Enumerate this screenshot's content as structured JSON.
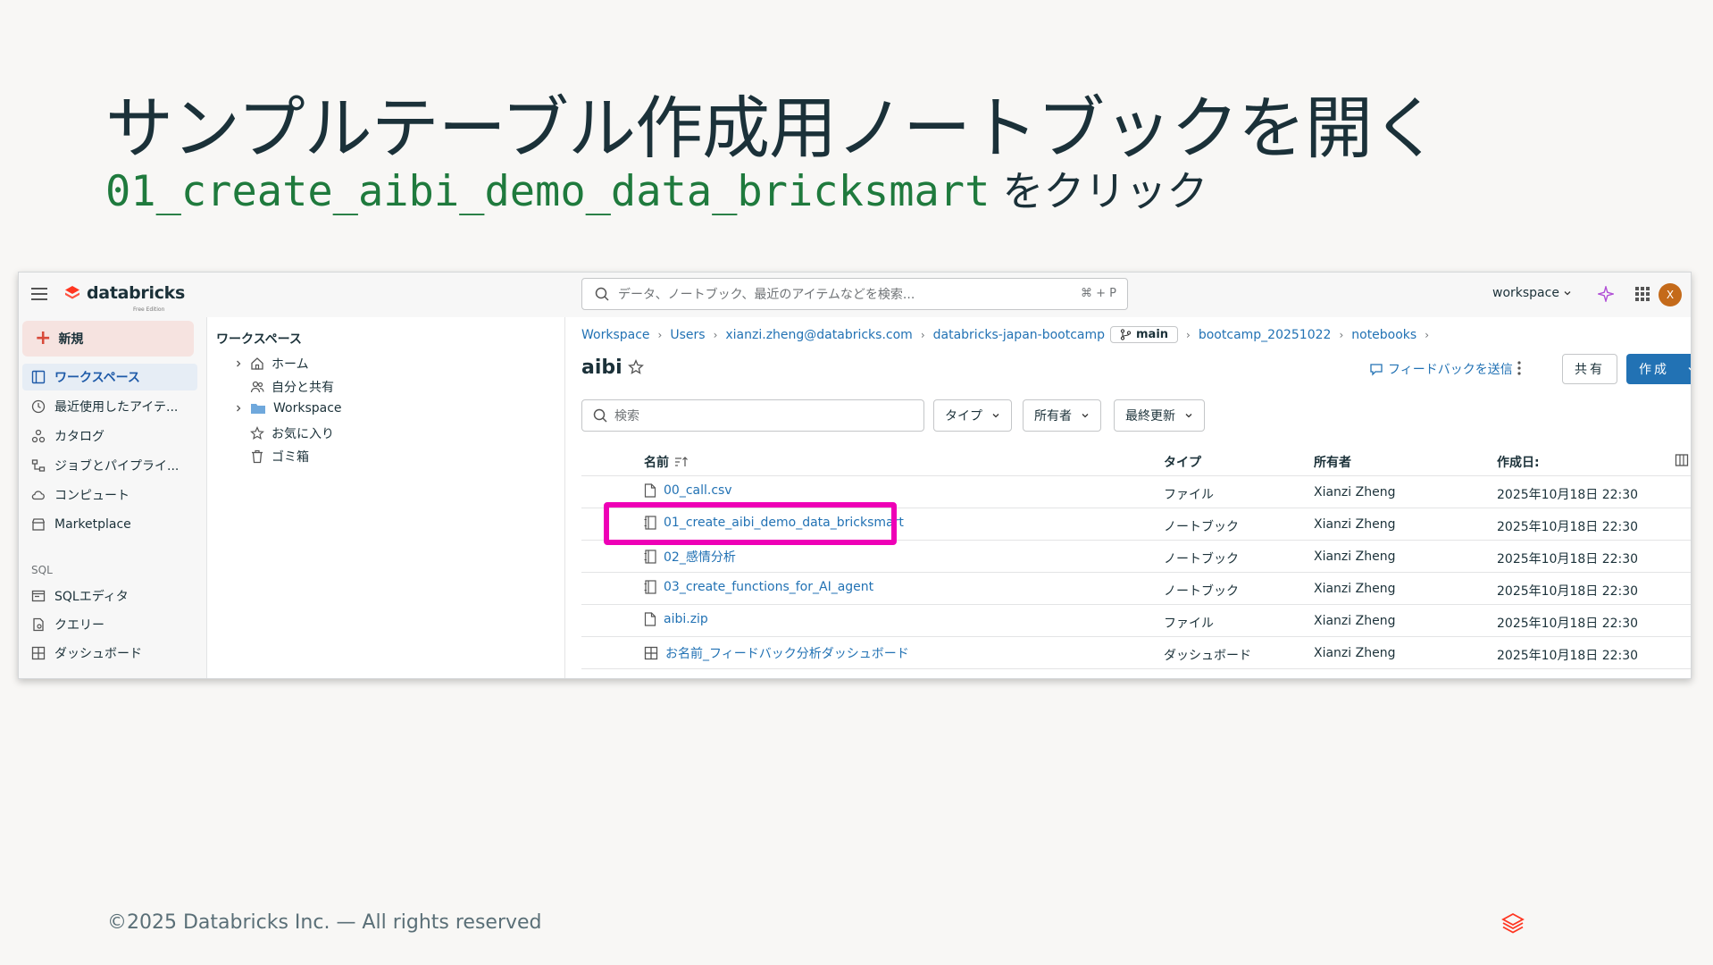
{
  "slide": {
    "title": "サンプルテーブル作成用ノートブックを開く",
    "subtitle_code": "01_create_aibi_demo_data_bricksmart",
    "subtitle_text": "をクリック",
    "footer": "©2025 Databricks Inc. — All rights reserved"
  },
  "topbar": {
    "brand": "databricks",
    "brand_sub": "Free Edition",
    "search_placeholder": "データ、ノートブック、最近のアイテムなどを検索...",
    "search_shortcut": "⌘ + P",
    "workspace": "workspace",
    "avatar": "X"
  },
  "sidebar": {
    "new_label": "新規",
    "items": [
      {
        "label": "ワークスペース",
        "icon": "workspace-icon"
      },
      {
        "label": "最近使用したアイテ...",
        "icon": "clock-icon"
      },
      {
        "label": "カタログ",
        "icon": "catalog-icon"
      },
      {
        "label": "ジョブとパイプライ...",
        "icon": "jobs-icon"
      },
      {
        "label": "コンピュート",
        "icon": "cloud-icon"
      },
      {
        "label": "Marketplace",
        "icon": "store-icon"
      }
    ],
    "sql_section": "SQL",
    "sql_items": [
      {
        "label": "SQLエディタ",
        "icon": "sql-editor-icon"
      },
      {
        "label": "クエリー",
        "icon": "query-icon"
      },
      {
        "label": "ダッシュボード",
        "icon": "dashboard-icon"
      }
    ]
  },
  "tree": {
    "title": "ワークスペース",
    "items": [
      {
        "label": "ホーム"
      },
      {
        "label": "自分と共有"
      },
      {
        "label": "Workspace"
      },
      {
        "label": "お気に入り"
      },
      {
        "label": "ゴミ箱"
      }
    ]
  },
  "main": {
    "breadcrumb": [
      "Workspace",
      "Users",
      "xianzi.zheng@databricks.com",
      "databricks-japan-bootcamp",
      "main",
      "bootcamp_20251022",
      "notebooks"
    ],
    "title": "aibi",
    "feedback": "フィードバックを送信",
    "share": "共有",
    "create": "作成",
    "filter_search_placeholder": "検索",
    "filters": [
      "タイプ",
      "所有者",
      "最終更新"
    ],
    "columns": {
      "name": "名前",
      "type": "タイプ",
      "owner": "所有者",
      "created": "作成日:"
    },
    "rows": [
      {
        "name": "00_call.csv",
        "type": "ファイル",
        "owner": "Xianzi Zheng",
        "created": "2025年10月18日 22:30",
        "icon": "file-icon"
      },
      {
        "name": "01_create_aibi_demo_data_bricksmart",
        "type": "ノートブック",
        "owner": "Xianzi Zheng",
        "created": "2025年10月18日 22:30",
        "icon": "notebook-icon"
      },
      {
        "name": "02_感情分析",
        "type": "ノートブック",
        "owner": "Xianzi Zheng",
        "created": "2025年10月18日 22:30",
        "icon": "notebook-icon"
      },
      {
        "name": "03_create_functions_for_AI_agent",
        "type": "ノートブック",
        "owner": "Xianzi Zheng",
        "created": "2025年10月18日 22:30",
        "icon": "notebook-icon"
      },
      {
        "name": "aibi.zip",
        "type": "ファイル",
        "owner": "Xianzi Zheng",
        "created": "2025年10月18日 22:30",
        "icon": "file-icon"
      },
      {
        "name": "お名前_フィードバック分析ダッシュボード",
        "type": "ダッシュボード",
        "owner": "Xianzi Zheng",
        "created": "2025年10月18日 22:30",
        "icon": "dashboard-icon"
      }
    ]
  },
  "colors": {
    "accent": "#2272b4",
    "highlight": "#ee00b6",
    "code_green": "#1f7a3d",
    "brand_red": "#ff3621"
  }
}
